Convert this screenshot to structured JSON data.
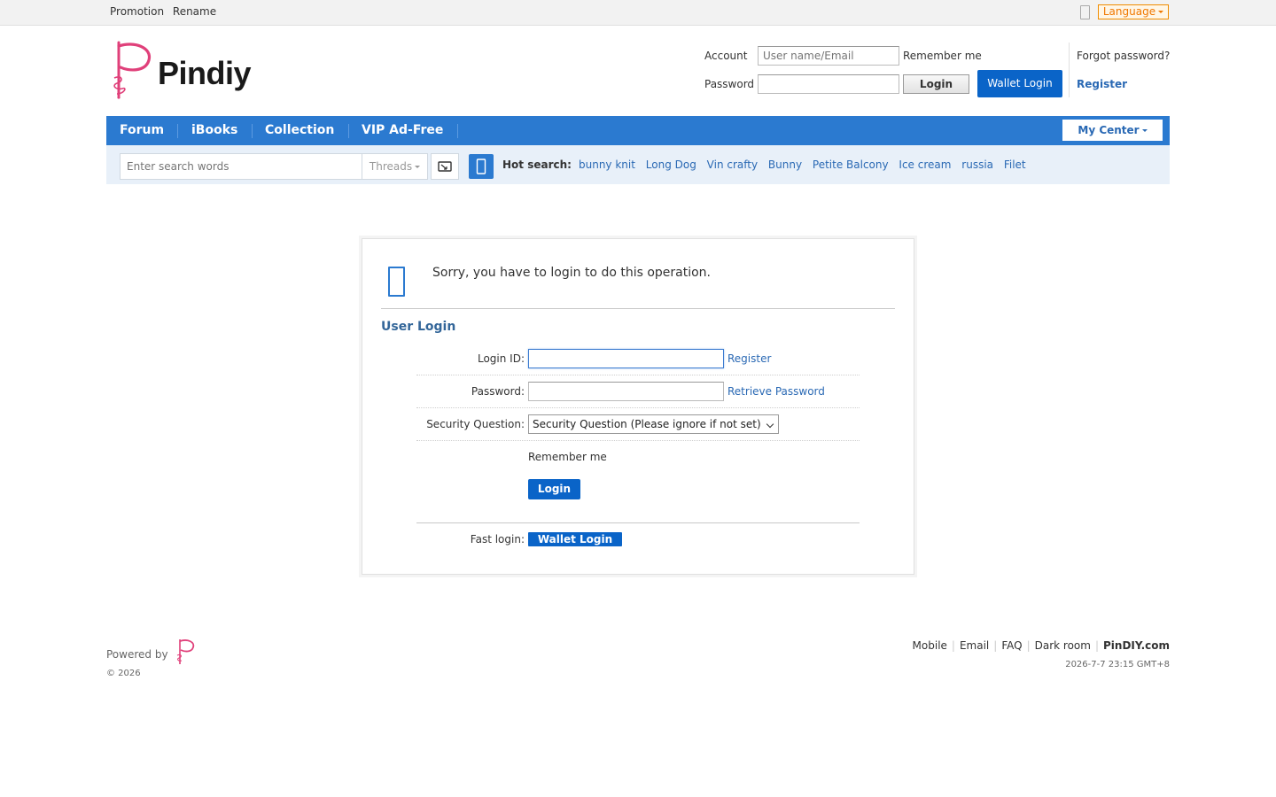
{
  "topbar": {
    "links": [
      "Promotion",
      "Rename"
    ],
    "language_label": "Language",
    "flag_icon": "flag-icon"
  },
  "brand": {
    "name": "Pindiy",
    "color": "#e0407a"
  },
  "header_login": {
    "account_label": "Account",
    "account_placeholder": "User name/Email",
    "remember_label": "Remember me",
    "password_label": "Password",
    "login_button": "Login",
    "wallet_button": "Wallet Login",
    "forgot_link": "Forgot password?",
    "register_link": "Register"
  },
  "nav": {
    "items": [
      "Forum",
      "iBooks",
      "Collection",
      "VIP Ad-Free"
    ],
    "my_center": "My Center",
    "color": "#2b7ad0"
  },
  "search": {
    "placeholder": "Enter search words",
    "type_select": "Threads",
    "hot_label": "Hot search:",
    "hot_terms": [
      "bunny knit",
      "Long Dog",
      "Vin crafty",
      "Bunny",
      "Petite Balcony",
      "Ice cream",
      "russia",
      "Filet"
    ]
  },
  "message": {
    "text": "Sorry, you have to login to do this operation.",
    "icon": "info-icon"
  },
  "login_form": {
    "title": "User Login",
    "login_id_label": "Login ID:",
    "login_id_value": "",
    "register_link": "Register",
    "password_label": "Password:",
    "password_value": "",
    "retrieve_link": "Retrieve Password",
    "security_label": "Security Question:",
    "security_selected": "Security Question (Please ignore if not set)",
    "remember_label": "Remember me",
    "login_button": "Login",
    "fast_login_label": "Fast login:",
    "wallet_button": "Wallet Login"
  },
  "footer": {
    "powered_by": "Powered by",
    "copyright": "© 2026",
    "links": [
      "Mobile",
      "Email",
      "FAQ",
      "Dark room"
    ],
    "site": "PinDIY.com",
    "timestamp": "2026-7-7 23:15 GMT+8"
  }
}
